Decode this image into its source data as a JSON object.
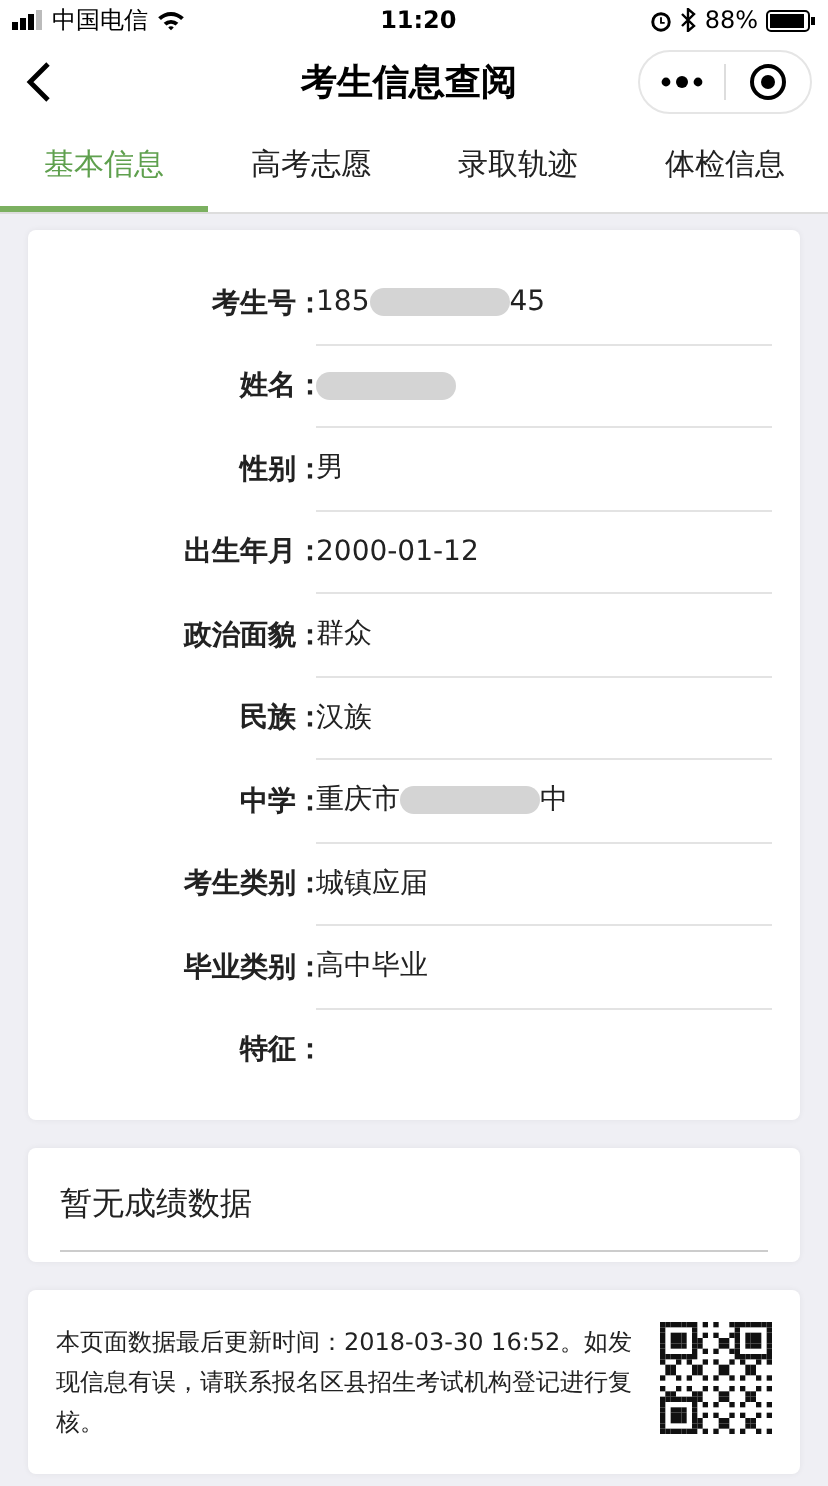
{
  "status_bar": {
    "carrier": "中国电信",
    "time": "11:20",
    "battery": "88%"
  },
  "nav": {
    "title": "考生信息查阅"
  },
  "tabs": [
    {
      "label": "基本信息",
      "selected": true
    },
    {
      "label": "高考志愿",
      "selected": false
    },
    {
      "label": "录取轨迹",
      "selected": false
    },
    {
      "label": "体检信息",
      "selected": false
    }
  ],
  "fields": [
    {
      "label": "考生号：",
      "value": [
        {
          "kind": "text",
          "text": "185"
        },
        {
          "kind": "redacted"
        },
        {
          "kind": "text",
          "text": "45"
        }
      ]
    },
    {
      "label": "姓名：",
      "value": [
        {
          "kind": "redacted"
        }
      ]
    },
    {
      "label": "性别：",
      "value": [
        {
          "kind": "text",
          "text": "男"
        }
      ]
    },
    {
      "label": "出生年月：",
      "value": [
        {
          "kind": "text",
          "text": "2000-01-12"
        }
      ]
    },
    {
      "label": "政治面貌：",
      "value": [
        {
          "kind": "text",
          "text": "群众"
        }
      ]
    },
    {
      "label": "民族：",
      "value": [
        {
          "kind": "text",
          "text": "汉族"
        }
      ]
    },
    {
      "label": "中学：",
      "value": [
        {
          "kind": "text",
          "text": "重庆市"
        },
        {
          "kind": "redacted"
        },
        {
          "kind": "text",
          "text": "中"
        }
      ]
    },
    {
      "label": "考生类别：",
      "value": [
        {
          "kind": "text",
          "text": "城镇应届"
        }
      ]
    },
    {
      "label": "毕业类别：",
      "value": [
        {
          "kind": "text",
          "text": "高中毕业"
        }
      ]
    },
    {
      "label": "特征："
    }
  ],
  "scores": {
    "message": "暂无成绩数据"
  },
  "footer": {
    "note": "本页面数据最后更新时间：2018-03-30 16:52。如发现信息有误，请联系报名区县招生考试机构登记进行复核。"
  }
}
